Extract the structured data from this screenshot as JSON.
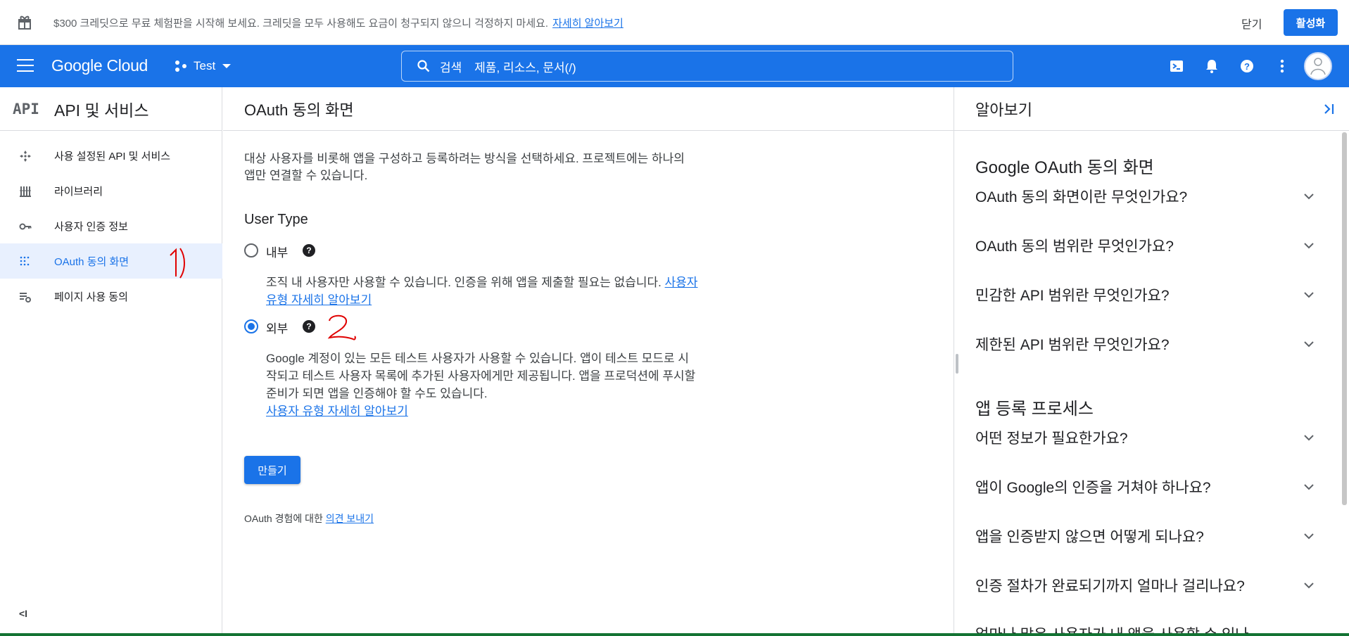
{
  "banner": {
    "message": "$300 크레딧으로 무료 체험판을 시작해 보세요. 크레딧을 모두 사용해도 요금이 청구되지 않으니 걱정하지 마세요.",
    "link": "자세히 알아보기",
    "close_label": "닫기",
    "activate_label": "활성화"
  },
  "topbar": {
    "logo": "Google Cloud",
    "project": "Test",
    "search_label": "검색",
    "search_placeholder": "제품, 리소스, 문서(/)",
    "bg_color": "#1a73e8"
  },
  "sidebar": {
    "mark": "API",
    "title": "API 및 서비스",
    "items": [
      {
        "label": "사용 설정된 API 및 서비스",
        "icon": "api-diamond-icon"
      },
      {
        "label": "라이브러리",
        "icon": "library-icon"
      },
      {
        "label": "사용자 인증 정보",
        "icon": "key-icon"
      },
      {
        "label": "OAuth 동의 화면",
        "icon": "oauth-grid-icon",
        "active": true
      },
      {
        "label": "페이지 사용 동의",
        "icon": "settings-list-icon"
      }
    ],
    "collapse_label": "<I"
  },
  "main": {
    "title": "OAuth 동의 화면",
    "intro": "대상 사용자를 비롯해 앱을 구성하고 등록하려는 방식을 선택하세요. 프로젝트에는 하나의 앱만 연결할 수 있습니다.",
    "user_type_title": "User Type",
    "internal": {
      "label": "내부",
      "desc": "조직 내 사용자만 사용할 수 있습니다. 인증을 위해 앱을 제출할 필요는 없습니다.",
      "link": "사용자 유형 자세히 알아보기",
      "selected": false
    },
    "external": {
      "label": "외부",
      "desc": "Google 계정이 있는 모든 테스트 사용자가 사용할 수 있습니다. 앱이 테스트 모드로 시작되고 테스트 사용자 목록에 추가된 사용자에게만 제공됩니다. 앱을 프로덕션에 푸시할 준비가 되면 앱을 인증해야 할 수도 있습니다.",
      "link": "사용자 유형 자세히 알아보기",
      "selected": true
    },
    "create_label": "만들기",
    "feedback_prefix": "OAuth 경험에 대한",
    "feedback_link": "의견 보내기"
  },
  "help_panel": {
    "title": "알아보기",
    "section1_title": "Google OAuth 동의 화면",
    "section1_items": [
      "OAuth 동의 화면이란 무엇인가요?",
      "OAuth 동의 범위란 무엇인가요?",
      "민감한 API 범위란 무엇인가요?",
      "제한된 API 범위란 무엇인가요?"
    ],
    "section2_title": "앱 등록 프로세스",
    "section2_items": [
      "어떤 정보가 필요한가요?",
      "앱이 Google의 인증을 거쳐야 하나요?",
      "앱을 인증받지 않으면 어떻게 되나요?",
      "인증 절차가 완료되기까지 얼마나 걸리나요?",
      "얼마나 많은 사용자가 내 앱을 사용할 수 있나"
    ]
  },
  "colors": {
    "accent": "#1a73e8",
    "annotation": "#e00000"
  }
}
